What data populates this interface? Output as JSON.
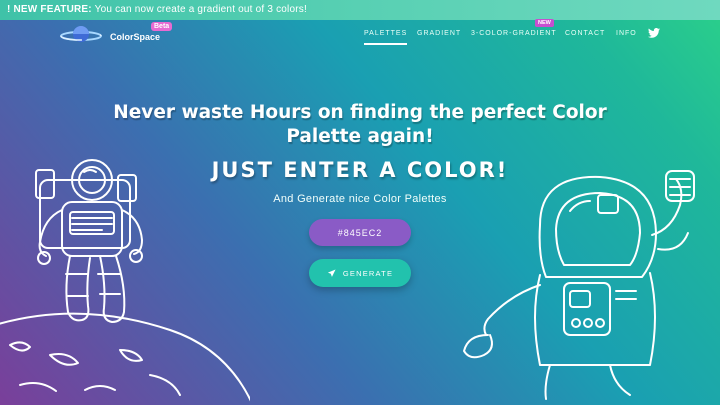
{
  "banner": {
    "label": "! NEW FEATURE:",
    "text": "You can now create a gradient out of 3 colors!"
  },
  "logo": {
    "name": "ColorSpace",
    "badge": "Beta"
  },
  "nav": {
    "items": [
      {
        "label": "PALETTES",
        "active": true
      },
      {
        "label": "GRADIENT",
        "active": false
      },
      {
        "label": "3-COLOR-GRADIENT",
        "active": false,
        "badge": "NEW"
      },
      {
        "label": "CONTACT",
        "active": false
      },
      {
        "label": "INFO",
        "active": false
      }
    ],
    "social_icon": "twitter-icon"
  },
  "hero": {
    "headline_line1": "Never waste Hours on finding the perfect Color",
    "headline_line2": "Palette again!",
    "subhead": "JUST ENTER A COLOR!",
    "tagline": "And Generate nice Color Palettes"
  },
  "color_input": {
    "value": "#845EC2"
  },
  "generate_button": {
    "label": "GENERATE",
    "icon": "rocket-icon"
  },
  "colors": {
    "input_bg": "#845EC2",
    "button_bg": "#22C2AD",
    "beta_badge": "#E86AD2",
    "new_badge": "#C64FCF"
  }
}
